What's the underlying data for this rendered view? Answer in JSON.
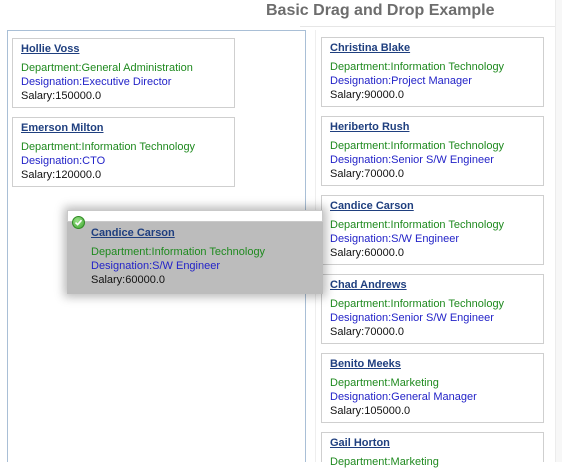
{
  "title": "Basic Drag and Drop Example",
  "left_list": [
    {
      "name": "Hollie Voss",
      "department": "Department:General Administration",
      "designation": "Designation:Executive Director",
      "salary": "Salary:150000.0"
    },
    {
      "name": "Emerson Milton",
      "department": "Department:Information Technology",
      "designation": "Designation:CTO",
      "salary": "Salary:120000.0"
    }
  ],
  "right_list": [
    {
      "name": "Christina Blake",
      "department": "Department:Information Technology",
      "designation": "Designation:Project Manager",
      "salary": "Salary:90000.0"
    },
    {
      "name": "Heriberto Rush",
      "department": "Department:Information Technology",
      "designation": "Designation:Senior S/W Engineer",
      "salary": "Salary:70000.0"
    },
    {
      "name": "Candice Carson",
      "department": "Department:Information Technology",
      "designation": "Designation:S/W Engineer",
      "salary": "Salary:60000.0"
    },
    {
      "name": "Chad Andrews",
      "department": "Department:Information Technology",
      "designation": "Designation:Senior S/W Engineer",
      "salary": "Salary:70000.0"
    },
    {
      "name": "Benito Meeks",
      "department": "Department:Marketing",
      "designation": "Designation:General Manager",
      "salary": "Salary:105000.0"
    },
    {
      "name": "Gail Horton",
      "department": "Department:Marketing",
      "designation": "",
      "salary": ""
    }
  ],
  "drag_proxy": {
    "name": "Candice Carson",
    "department": "Department:Information Technology",
    "designation": "Designation:S/W Engineer",
    "salary": "Salary:60000.0",
    "status_icon": "check-circle-icon"
  },
  "colors": {
    "name": "#1f3f7f",
    "department": "#1f8a1f",
    "designation": "#2323c8",
    "title": "#6d6d6d"
  }
}
